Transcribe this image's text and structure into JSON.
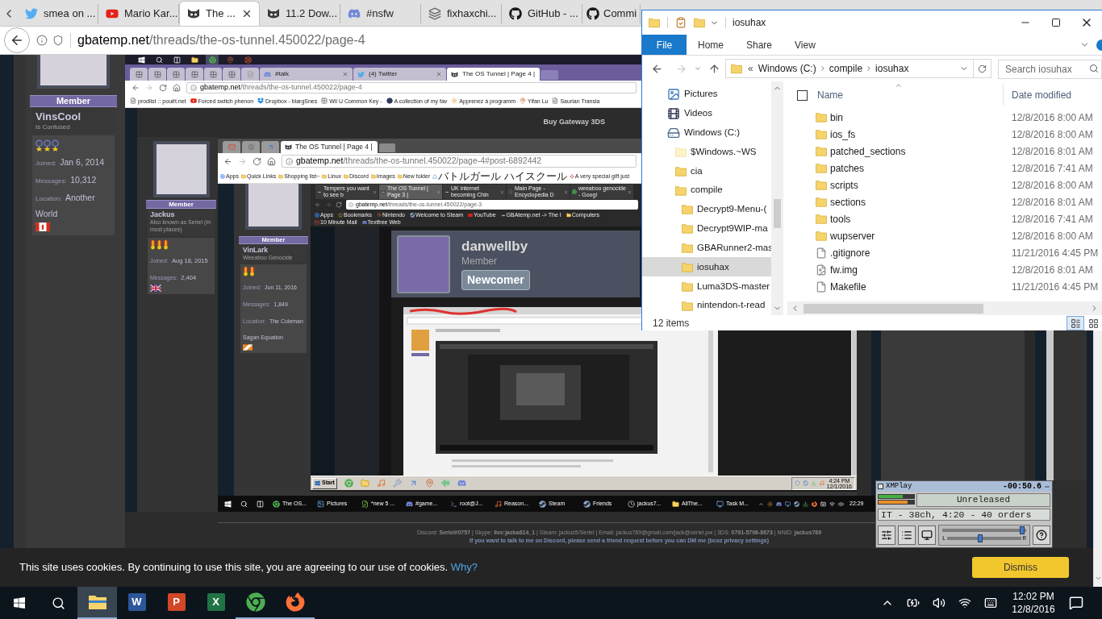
{
  "browser": {
    "tabs": [
      {
        "title": "smea on ...",
        "kind": "bird",
        "selected": false
      },
      {
        "title": "Mario Kar...",
        "kind": "play",
        "selected": false
      },
      {
        "title": "The ...",
        "kind": "mascot",
        "selected": true
      },
      {
        "title": "11.2 Dow...",
        "kind": "mascot",
        "selected": false
      },
      {
        "title": "#nsfw",
        "kind": "chat",
        "selected": false
      },
      {
        "title": "fixhaxchi...",
        "kind": "stack",
        "selected": false
      },
      {
        "title": "GitHub - ...",
        "kind": "cat",
        "selected": false
      },
      {
        "title": "Commi",
        "kind": "cat",
        "selected": false
      }
    ],
    "url": {
      "domain": "gbatemp.net",
      "path": "/threads/the-os-tunnel.450022/page-4"
    }
  },
  "profile": {
    "rank": "Member",
    "name": "VinsCool",
    "title": "Is Confused",
    "medals": [
      {
        "kind": "ring"
      },
      {
        "kind": "ring"
      },
      {
        "kind": "ring"
      }
    ],
    "stats": [
      {
        "label": "Joined:",
        "value": "Jan 6, 2014"
      },
      {
        "label": "Messages:",
        "value": "10,312"
      },
      {
        "label": "Location:",
        "value": "Another World"
      }
    ],
    "flag": {
      "kind": "canada"
    }
  },
  "screenshot": {
    "taskbar_icons": [
      {
        "kind": "windows",
        "selected": false
      },
      {
        "kind": "search",
        "selected": false
      },
      {
        "kind": "taskview",
        "selected": false
      },
      {
        "kind": "folder",
        "selected": false
      },
      {
        "kind": "browser",
        "selected": true
      },
      {
        "kind": "pin",
        "selected": false
      },
      {
        "kind": "lifebuoy",
        "selected": false
      }
    ],
    "tabs": [
      {
        "kind": "grid",
        "selected": false
      },
      {
        "kind": "grid",
        "selected": false
      },
      {
        "kind": "grid",
        "selected": false
      },
      {
        "kind": "grid",
        "selected": false
      },
      {
        "kind": "grid",
        "selected": false
      },
      {
        "kind": "grid",
        "selected": false
      },
      {
        "kind": "doc",
        "selected": false
      },
      {
        "title": "#talk",
        "kind": "chat",
        "selected": false
      },
      {
        "title": "(4) Twitter",
        "kind": "bird",
        "selected": false
      },
      {
        "title": "The OS Tunnel | Page 4 |",
        "kind": "mascot",
        "selected": true
      }
    ],
    "url": {
      "domain": "gbatemp.net",
      "path": "/threads/the-os-tunnel.450022/page-4"
    },
    "bookmarks": [
      {
        "title": "prodlist :: pouët.net",
        "kind": "page"
      },
      {
        "title": "Forced switch phenon",
        "kind": "play"
      },
      {
        "title": "Dropbox - blargSnes",
        "kind": "box"
      },
      {
        "title": "Wii U Common Key -",
        "kind": "grid"
      },
      {
        "title": "A collection of my fav",
        "kind": "dot"
      },
      {
        "title": "Apprenez à programm",
        "kind": "sun"
      },
      {
        "title": "Yifan Lu",
        "kind": "pin"
      },
      {
        "title": "Saurian Transla",
        "kind": "page"
      }
    ],
    "header_link": "Buy Gateway 3DS",
    "profile": {
      "rank": "Member",
      "name": "Jackus",
      "title": "Also known as Seriel (In most places)",
      "medals": [
        {
          "kind": "ribbon"
        },
        {
          "kind": "ribbon"
        },
        {
          "kind": "ribbon"
        }
      ],
      "stats": [
        {
          "label": "Joined:",
          "value": "Aug 18, 2015"
        },
        {
          "label": "Messages:",
          "value": "2,404"
        }
      ],
      "flag": {
        "kind": "uk"
      }
    },
    "screenshot": {
      "tabs": [
        {
          "kind": "mail",
          "selected": false
        },
        {
          "kind": "gear",
          "selected": false
        },
        {
          "kind": "arrow",
          "selected": false
        },
        {
          "title": "The OS Tunnel | Page 4 |",
          "kind": "mascot",
          "selected": true
        }
      ],
      "url": {
        "domain": "gbatemp.net",
        "path": "/threads/the-os-tunnel.450022/page-4#post-6892442"
      },
      "bookmarks": [
        {
          "title": "Apps",
          "kind": "apps"
        },
        {
          "title": "Quick Links",
          "kind": "folder"
        },
        {
          "title": "Shopping list~",
          "kind": "folder"
        },
        {
          "title": "Linux",
          "kind": "folder"
        },
        {
          "title": "Discord",
          "kind": "folder"
        },
        {
          "title": "Images",
          "kind": "folder"
        },
        {
          "title": "New folder",
          "kind": "folder"
        },
        {
          "title": "バトルガール ハイスクール",
          "kind": "triangle"
        },
        {
          "title": "A very special gift just",
          "kind": "spark"
        }
      ],
      "profile": {
        "rank": "Member",
        "name": "VinLark",
        "title": "Weeaboo Genocide",
        "medals": [
          {
            "kind": "ribbon"
          },
          {
            "kind": "ribbon"
          }
        ],
        "stats": [
          {
            "label": "Joined:",
            "value": "Jun 11, 2016"
          },
          {
            "label": "Messages:",
            "value": "1,849"
          },
          {
            "label": "Location:",
            "value": "The Coleman Sagan Equation"
          }
        ],
        "flag": {
          "kind": "stripes"
        }
      },
      "screenshot": {
        "tabs": [
          {
            "title": "Tempers you want to see b",
            "kind": "mascot",
            "selected": false
          },
          {
            "title": "The OS Tunnel | Page 3 |",
            "kind": "mascot",
            "selected": true
          },
          {
            "title": "UK internet becoming Chin",
            "kind": "mascot",
            "selected": false
          },
          {
            "title": "Main Page - Encyclopedia D",
            "kind": "page",
            "selected": false
          },
          {
            "title": "weeaboo genocide - Googl",
            "kind": "browser",
            "selected": false
          }
        ],
        "url": {
          "domain": "gbatemp.net",
          "path": "/threads/the-os-tunnel.450022/page-3"
        },
        "bookmarks": [
          {
            "title": "Apps",
            "kind": "apps"
          },
          {
            "title": "Bookmarks",
            "kind": "star"
          },
          {
            "title": "Nintendo",
            "kind": "pin"
          },
          {
            "title": "Welcome to Steam",
            "kind": "steam"
          },
          {
            "title": "YouTube",
            "kind": "play"
          },
          {
            "title": "GBAtemp.net -> The I",
            "kind": "mascot"
          },
          {
            "title": "Computers",
            "kind": "folder"
          },
          {
            "title": "10 Minute Mail",
            "kind": "mail"
          },
          {
            "title": "Textfree Web",
            "kind": "chat"
          }
        ],
        "post_author": {
          "name": "danwellby",
          "rank": "Member",
          "badge": "Newcomer"
        },
        "taskbar": {
          "start": "Start",
          "icons": [
            {
              "kind": "browser"
            },
            {
              "kind": "folder"
            },
            {
              "kind": "music"
            },
            {
              "kind": "tools"
            },
            {
              "kind": "arrow"
            },
            {
              "kind": "pin"
            },
            {
              "kind": "waves"
            },
            {
              "kind": "chat"
            }
          ],
          "tray": [
            {
              "kind": "shield"
            },
            {
              "kind": "steam"
            },
            {
              "kind": "download"
            },
            {
              "kind": "music"
            }
          ],
          "time": "4:24 PM",
          "date": "12/1/2016"
        }
      },
      "taskbar": {
        "apps": [
          {
            "label": "The OS...",
            "kind": "browser"
          },
          {
            "label": "Pictures",
            "kind": "image"
          },
          {
            "label": "*new 5 ...",
            "kind": "note"
          },
          {
            "label": "#game...",
            "kind": "chat"
          },
          {
            "label": "root@J...",
            "kind": "terminal"
          },
          {
            "label": "Reason...",
            "kind": "music"
          },
          {
            "label": "Steam",
            "kind": "steam"
          },
          {
            "label": "Friends",
            "kind": "steam"
          },
          {
            "label": "jackus7...",
            "kind": "clock"
          },
          {
            "label": "AllThe...",
            "kind": "folder"
          },
          {
            "label": "Task M...",
            "kind": "monitor"
          }
        ],
        "tray": [
          {
            "kind": "chevron"
          },
          {
            "kind": "sun"
          },
          {
            "kind": "chat"
          },
          {
            "kind": "monitor"
          },
          {
            "kind": "steam"
          },
          {
            "kind": "download"
          },
          {
            "kind": "firefox"
          },
          {
            "kind": "keyboard"
          },
          {
            "kind": "wifi"
          },
          {
            "kind": "volume"
          }
        ],
        "clock": "22:29"
      }
    },
    "signature": {
      "contacts": "Discord: **Seriel#0757** | Skype: **live:jacka614_1** | Steam: jackus5/Seriel | Email: jackus789@gmail.com/jack@seriel.pw | 3DS: **0791-5706-8673** | NNID: **jackus789**",
      "note": "If you want to talk to me on Discord, please send a friend request before you can DM me (bcoz privacy settings)"
    }
  },
  "explorer": {
    "title": "iosuhax",
    "ribbon_tabs": [
      {
        "label": "File",
        "selected": true
      },
      {
        "label": "Home",
        "selected": false
      },
      {
        "label": "Share",
        "selected": false
      },
      {
        "label": "View",
        "selected": false
      }
    ],
    "path_overflow": "«",
    "path": [
      "Windows (C:)",
      "compile",
      "iosuhax"
    ],
    "search": {
      "placeholder": "Search iosuhax"
    },
    "nav": [
      {
        "label": "Pictures",
        "kind": "pictures",
        "selected": false
      },
      {
        "label": "Videos",
        "kind": "videos",
        "selected": false
      },
      {
        "label": "Windows (C:)",
        "kind": "drive",
        "selected": false,
        "children": [
          {
            "label": "$Windows.~WS",
            "kind": "hidden",
            "selected": false
          },
          {
            "label": "cia",
            "kind": "folder",
            "selected": false
          },
          {
            "label": "compile",
            "kind": "folder",
            "selected": false,
            "children": [
              {
                "label": "Decrypt9-Menu-(",
                "kind": "folder",
                "selected": false
              },
              {
                "label": "Decrypt9WIP-ma",
                "kind": "folder",
                "selected": false
              },
              {
                "label": "GBARunner2-mas",
                "kind": "folder",
                "selected": false
              },
              {
                "label": "iosuhax",
                "kind": "folder",
                "selected": true
              },
              {
                "label": "Luma3DS-master",
                "kind": "folder",
                "selected": false
              },
              {
                "label": "nintendon-t-read",
                "kind": "folder",
                "selected": false
              }
            ]
          }
        ]
      }
    ],
    "select_all": {
      "checked": false
    },
    "columns": [
      "Name",
      "Date modified"
    ],
    "files": [
      {
        "name": "bin",
        "date": "12/8/2016 8:00 AM",
        "kind": "folder"
      },
      {
        "name": "ios_fs",
        "date": "12/8/2016 8:00 AM",
        "kind": "folder"
      },
      {
        "name": "patched_sections",
        "date": "12/8/2016 8:01 AM",
        "kind": "folder"
      },
      {
        "name": "patches",
        "date": "12/8/2016 7:41 AM",
        "kind": "folder"
      },
      {
        "name": "scripts",
        "date": "12/8/2016 8:00 AM",
        "kind": "folder"
      },
      {
        "name": "sections",
        "date": "12/8/2016 8:01 AM",
        "kind": "folder"
      },
      {
        "name": "tools",
        "date": "12/8/2016 7:41 AM",
        "kind": "folder"
      },
      {
        "name": "wupserver",
        "date": "12/8/2016 8:00 AM",
        "kind": "folder"
      },
      {
        "name": ".gitignore",
        "date": "11/21/2016 4:45 PM",
        "kind": "file"
      },
      {
        "name": "fw.img",
        "date": "12/8/2016 8:01 AM",
        "kind": "image"
      },
      {
        "name": "Makefile",
        "date": "11/21/2016 4:45 PM",
        "kind": "file"
      }
    ],
    "status": "12 items",
    "views": [
      {
        "kind": "details",
        "selected": true
      },
      {
        "kind": "tiles",
        "selected": false
      }
    ]
  },
  "xmplay": {
    "title": "XMPlay",
    "time": "-00:50.6",
    "track": "Unreleased",
    "info": "IT - 38ch, 4:20 - 40 orders",
    "sliders": [
      {
        "level": 0.95
      },
      {
        "level": 0.45
      }
    ],
    "left": "L",
    "right": "R"
  },
  "cookie_bar": {
    "text": "This site uses cookies. By continuing to use this site, you are agreeing to our use of cookies.",
    "link": "Why?",
    "button": "Dismiss"
  },
  "taskbar": {
    "apps": [
      {
        "kind": "explorer",
        "selected": true,
        "running": true
      },
      {
        "kind": "word",
        "letter": "W",
        "selected": false,
        "running": false
      },
      {
        "kind": "powerpoint",
        "letter": "P",
        "selected": false,
        "running": false
      },
      {
        "kind": "excel",
        "letter": "X",
        "selected": false,
        "running": false
      },
      {
        "kind": "chrome",
        "selected": false,
        "running": true
      },
      {
        "kind": "firefox",
        "selected": false,
        "running": true
      }
    ],
    "tray": [
      {
        "kind": "chevron"
      },
      {
        "kind": "battery"
      },
      {
        "kind": "volume"
      },
      {
        "kind": "wifi"
      },
      {
        "kind": "keyboard"
      }
    ],
    "time": "12:02 PM",
    "date": "12/8/2016"
  }
}
